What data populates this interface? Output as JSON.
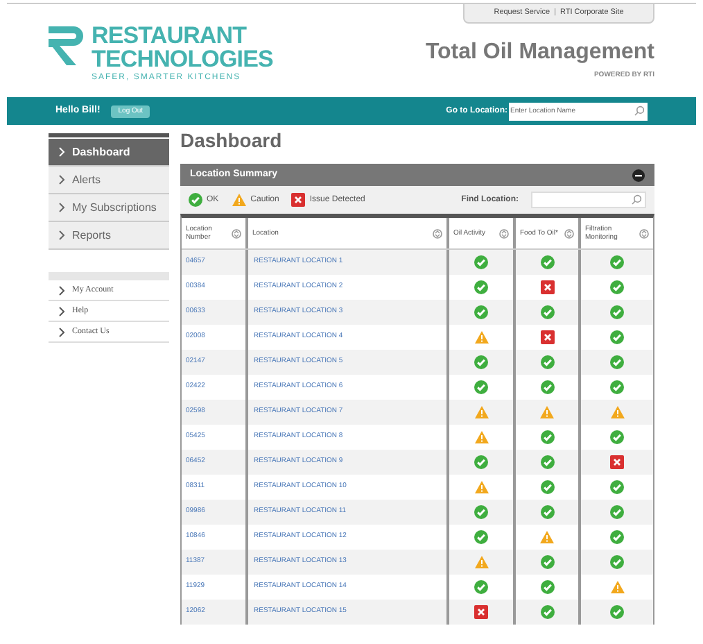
{
  "top_links": [
    "Request Service",
    "RTI Corporate Site"
  ],
  "top_links_separator": "|",
  "logo": {
    "line1": "RESTAURANT",
    "line2": "TECHNOLOGIES",
    "tagline": "SAFER, SMARTER KITCHENS"
  },
  "product": {
    "title": "Total Oil Management",
    "subtitle": "POWERED BY RTI"
  },
  "nav_bar": {
    "greeting": "Hello Bill!",
    "logout": "Log Out",
    "goto_label": "Go to Location:",
    "goto_placeholder": "Enter Location Name"
  },
  "sidebar": {
    "items": [
      {
        "label": "Dashboard",
        "selected": true
      },
      {
        "label": "Alerts",
        "selected": false
      },
      {
        "label": "My Subscriptions",
        "selected": false
      },
      {
        "label": "Reports",
        "selected": false
      }
    ],
    "secondary": [
      "My Account",
      "Help",
      "Contact Us"
    ]
  },
  "page_title": "Dashboard",
  "panel": {
    "title": "Location Summary",
    "legend": [
      {
        "kind": "ok",
        "label": "OK"
      },
      {
        "kind": "caution",
        "label": "Caution"
      },
      {
        "kind": "issue",
        "label": "Issue Detected"
      }
    ],
    "find_label": "Find Location:"
  },
  "table": {
    "columns": [
      "Location Number",
      "Location",
      "Oil Activity",
      "Food To Oil*",
      "Filtration Monitoring"
    ],
    "rows": [
      {
        "number": "04657",
        "location": "RESTAURANT LOCATION 1",
        "status": [
          {
            "kind": "ok"
          },
          {
            "kind": "ok"
          },
          {
            "kind": "ok"
          }
        ]
      },
      {
        "number": "00384",
        "location": "RESTAURANT LOCATION 2",
        "status": [
          {
            "kind": "ok"
          },
          {
            "kind": "issue"
          },
          {
            "kind": "ok"
          }
        ]
      },
      {
        "number": "00633",
        "location": "RESTAURANT LOCATION 3",
        "status": [
          {
            "kind": "ok"
          },
          {
            "kind": "ok"
          },
          {
            "kind": "ok"
          }
        ]
      },
      {
        "number": "02008",
        "location": "RESTAURANT LOCATION 4",
        "status": [
          {
            "kind": "caution"
          },
          {
            "kind": "issue"
          },
          {
            "kind": "ok"
          }
        ]
      },
      {
        "number": "02147",
        "location": "RESTAURANT LOCATION 5",
        "status": [
          {
            "kind": "ok"
          },
          {
            "kind": "ok"
          },
          {
            "kind": "ok"
          }
        ]
      },
      {
        "number": "02422",
        "location": "RESTAURANT LOCATION 6",
        "status": [
          {
            "kind": "ok"
          },
          {
            "kind": "ok"
          },
          {
            "kind": "ok"
          }
        ]
      },
      {
        "number": "02598",
        "location": "RESTAURANT LOCATION 7",
        "status": [
          {
            "kind": "caution"
          },
          {
            "kind": "caution"
          },
          {
            "kind": "caution"
          }
        ]
      },
      {
        "number": "05425",
        "location": "RESTAURANT LOCATION 8",
        "status": [
          {
            "kind": "caution"
          },
          {
            "kind": "ok"
          },
          {
            "kind": "ok"
          }
        ]
      },
      {
        "number": "06452",
        "location": "RESTAURANT LOCATION 9",
        "status": [
          {
            "kind": "ok"
          },
          {
            "kind": "ok"
          },
          {
            "kind": "issue"
          }
        ]
      },
      {
        "number": "08311",
        "location": "RESTAURANT LOCATION 10",
        "status": [
          {
            "kind": "caution"
          },
          {
            "kind": "ok"
          },
          {
            "kind": "ok"
          }
        ]
      },
      {
        "number": "09986",
        "location": "RESTAURANT LOCATION 11",
        "status": [
          {
            "kind": "ok"
          },
          {
            "kind": "ok"
          },
          {
            "kind": "ok"
          }
        ]
      },
      {
        "number": "10846",
        "location": "RESTAURANT LOCATION 12",
        "status": [
          {
            "kind": "ok"
          },
          {
            "kind": "caution"
          },
          {
            "kind": "ok"
          }
        ]
      },
      {
        "number": "11387",
        "location": "RESTAURANT LOCATION 13",
        "status": [
          {
            "kind": "caution"
          },
          {
            "kind": "ok"
          },
          {
            "kind": "ok"
          }
        ]
      },
      {
        "number": "11929",
        "location": "RESTAURANT LOCATION 14",
        "status": [
          {
            "kind": "ok"
          },
          {
            "kind": "ok"
          },
          {
            "kind": "caution"
          }
        ]
      },
      {
        "number": "12062",
        "location": "RESTAURANT LOCATION 15",
        "status": [
          {
            "kind": "issue"
          },
          {
            "kind": "ok"
          },
          {
            "kind": "ok"
          }
        ]
      }
    ]
  }
}
